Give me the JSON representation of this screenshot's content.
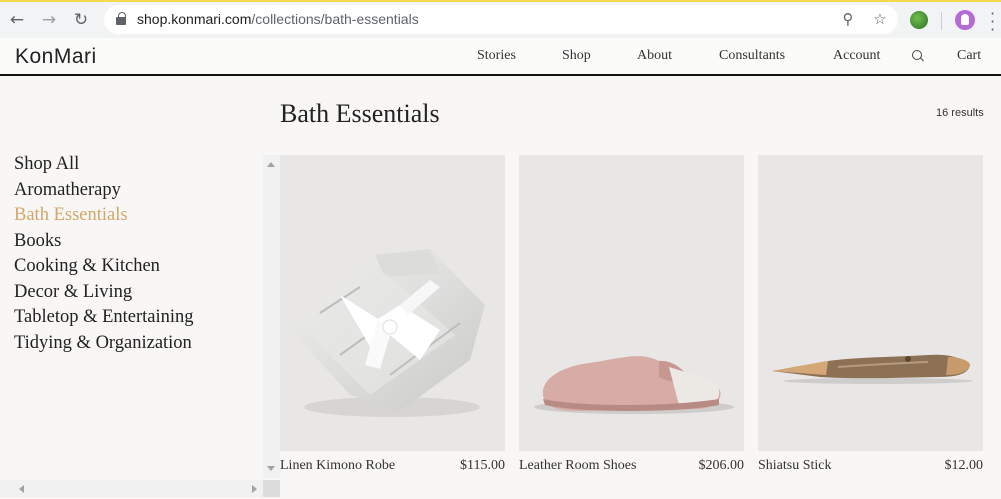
{
  "browser": {
    "url_host": "shop.konmari.com",
    "url_path": "/collections/bath-essentials",
    "icons": [
      "back-icon",
      "forward-icon",
      "reload-icon",
      "lock-icon",
      "zoom-icon",
      "star-icon",
      "extension-icon",
      "profile-icon",
      "menu-icon"
    ]
  },
  "site": {
    "logo": "KonMari",
    "nav": [
      "Stories",
      "Shop",
      "About",
      "Consultants",
      "Account",
      "Cart"
    ]
  },
  "page": {
    "title": "Bath Essentials",
    "results": "16 results"
  },
  "sidebar": {
    "items": [
      "Shop All",
      "Aromatherapy",
      "Bath Essentials",
      "Books",
      "Cooking & Kitchen",
      "Decor & Living",
      "Tabletop & Entertaining",
      "Tidying & Organization"
    ],
    "active": "Bath Essentials"
  },
  "products": [
    {
      "name": "Linen Kimono Robe",
      "price": "$115.00"
    },
    {
      "name": "Leather Room Shoes",
      "price": "$206.00"
    },
    {
      "name": "Shiatsu Stick",
      "price": "$12.00"
    }
  ],
  "colors": {
    "accent": "#d3a769",
    "chrome_accent": "#f3d94e"
  }
}
